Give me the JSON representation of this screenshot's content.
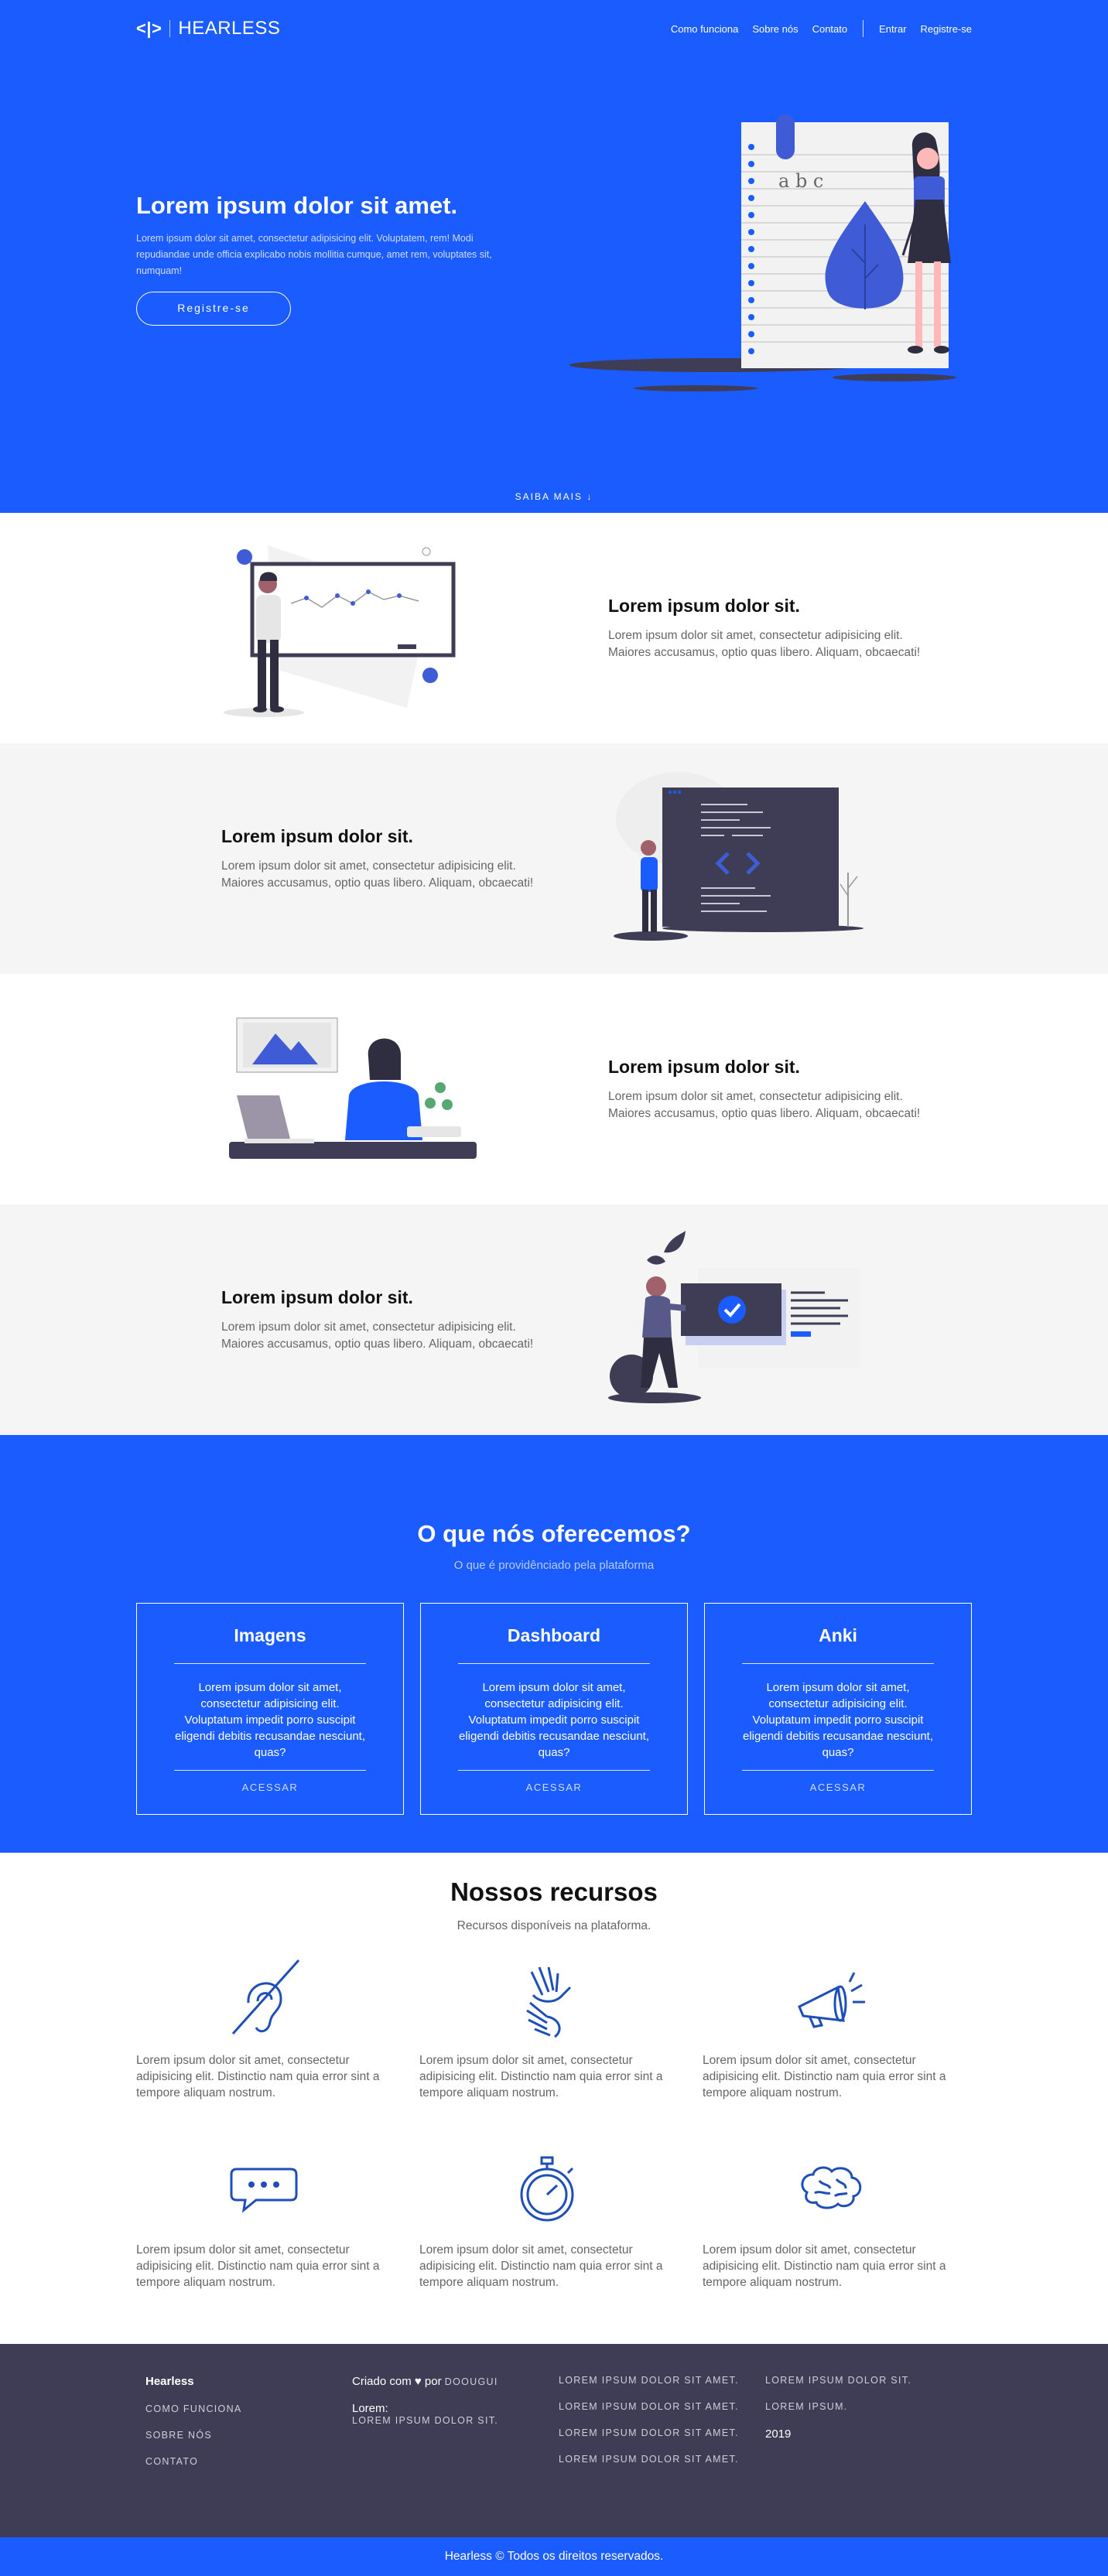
{
  "colors": {
    "primary": "#1a5cff",
    "dark": "#3f3d56",
    "gray_bg": "#f5f5f5"
  },
  "nav": {
    "logo_symbol": "<|>",
    "brand": "HEARLESS",
    "links": [
      "Como funciona",
      "Sobre nós",
      "Contato"
    ],
    "login": "Entrar",
    "register": "Registre-se"
  },
  "hero": {
    "title": "Lorem ipsum dolor sit amet.",
    "text": "Lorem ipsum dolor sit amet, consectetur adipisicing elit. Voluptatem, rem! Modi repudiandae unde officia explicabo nobis mollitia cumque, amet rem, voluptates sit, numquam!",
    "cta": "Registre-se",
    "scroll": "SAIBA MAIS ↓",
    "notebook_text": "a b c"
  },
  "features": [
    {
      "title": "Lorem ipsum dolor sit.",
      "text": "Lorem ipsum dolor sit amet, consectetur adipisicing elit. Maiores accusamus, optio quas libero. Aliquam, obcaecati!"
    },
    {
      "title": "Lorem ipsum dolor sit.",
      "text": "Lorem ipsum dolor sit amet, consectetur adipisicing elit. Maiores accusamus, optio quas libero. Aliquam, obcaecati!"
    },
    {
      "title": "Lorem ipsum dolor sit.",
      "text": "Lorem ipsum dolor sit amet, consectetur adipisicing elit. Maiores accusamus, optio quas libero. Aliquam, obcaecati!"
    },
    {
      "title": "Lorem ipsum dolor sit.",
      "text": "Lorem ipsum dolor sit amet, consectetur adipisicing elit. Maiores accusamus, optio quas libero. Aliquam, obcaecati!"
    }
  ],
  "offer": {
    "title": "O que nós oferecemos?",
    "subtitle": "O que é providênciado pela plataforma",
    "cards": [
      {
        "title": "Imagens",
        "text": "Lorem ipsum dolor sit amet, consectetur adipisicing elit. Voluptatum impedit porro suscipit eligendi debitis recusandae nesciunt, quas?",
        "action": "ACESSAR"
      },
      {
        "title": "Dashboard",
        "text": "Lorem ipsum dolor sit amet, consectetur adipisicing elit. Voluptatum impedit porro suscipit eligendi debitis recusandae nesciunt, quas?",
        "action": "ACESSAR"
      },
      {
        "title": "Anki",
        "text": "Lorem ipsum dolor sit amet, consectetur adipisicing elit. Voluptatum impedit porro suscipit eligendi debitis recusandae nesciunt, quas?",
        "action": "ACESSAR"
      }
    ]
  },
  "resources": {
    "title": "Nossos recursos",
    "subtitle": "Recursos disponíveis na plataforma.",
    "items": [
      {
        "icon": "deaf-ear-icon",
        "text": "Lorem ipsum dolor sit amet, consectetur adipisicing elit. Distinctio nam quia error sint a tempore aliquam nostrum."
      },
      {
        "icon": "sign-language-hands-icon",
        "text": "Lorem ipsum dolor sit amet, consectetur adipisicing elit. Distinctio nam quia error sint a tempore aliquam nostrum."
      },
      {
        "icon": "megaphone-icon",
        "text": "Lorem ipsum dolor sit amet, consectetur adipisicing elit. Distinctio nam quia error sint a tempore aliquam nostrum."
      },
      {
        "icon": "chat-bubble-icon",
        "text": "Lorem ipsum dolor sit amet, consectetur adipisicing elit. Distinctio nam quia error sint a tempore aliquam nostrum."
      },
      {
        "icon": "stopwatch-icon",
        "text": "Lorem ipsum dolor sit amet, consectetur adipisicing elit. Distinctio nam quia error sint a tempore aliquam nostrum."
      },
      {
        "icon": "brain-icon",
        "text": "Lorem ipsum dolor sit amet, consectetur adipisicing elit. Distinctio nam quia error sint a tempore aliquam nostrum."
      }
    ]
  },
  "footer": {
    "brand": "Hearless",
    "links": [
      "COMO FUNCIONA",
      "SOBRE NÓS",
      "CONTATO"
    ],
    "created_prefix": "Criado com ♥ por",
    "author": "DOOUGUI",
    "lorem_label": "Lorem:",
    "lorem_value": "LOREM IPSUM DOLOR SIT.",
    "col3": [
      "LOREM IPSUM DOLOR SIT AMET.",
      "LOREM IPSUM DOLOR SIT AMET.",
      "LOREM IPSUM DOLOR SIT AMET.",
      "LOREM IPSUM DOLOR SIT AMET."
    ],
    "col4": [
      "LOREM IPSUM DOLOR SIT.",
      "LOREM IPSUM."
    ],
    "year": "2019",
    "copyright": "Hearless © Todos os direitos reservados."
  }
}
